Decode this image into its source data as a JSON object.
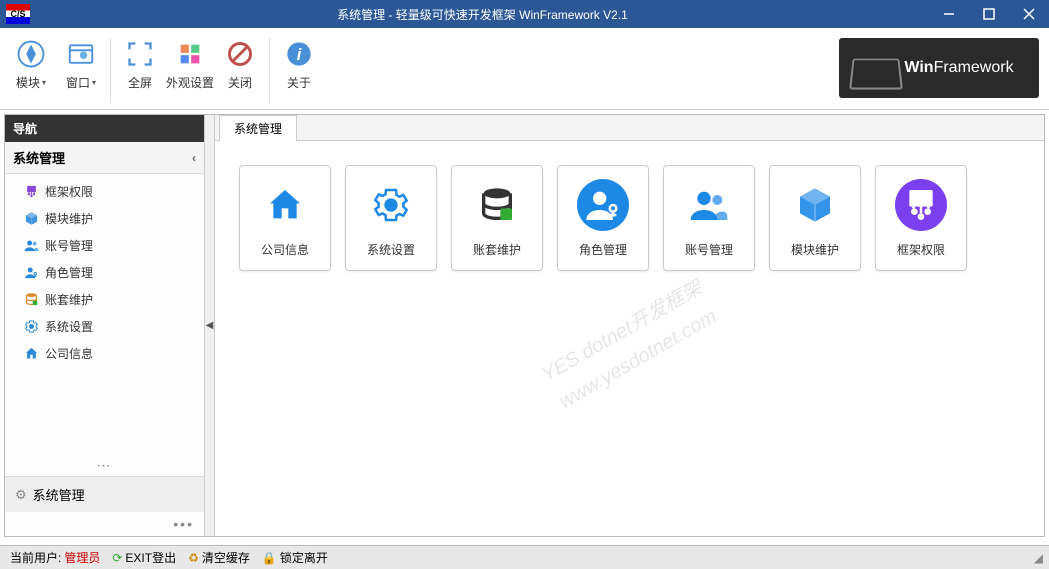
{
  "window": {
    "title": "系统管理 - 轻量级可快速开发框架 WinFramework V2.1"
  },
  "toolbar": {
    "module": "模块",
    "window": "窗口",
    "fullscreen": "全屏",
    "appearance": "外观设置",
    "close": "关闭",
    "about": "关于"
  },
  "brand": {
    "win": "Win",
    "framework": "Framework"
  },
  "sidebar": {
    "header": "导航",
    "section": "系统管理",
    "items": [
      {
        "label": "框架权限",
        "color": "#8a4ad9",
        "icon": "shield"
      },
      {
        "label": "模块维护",
        "color": "#2a8ad9",
        "icon": "cube"
      },
      {
        "label": "账号管理",
        "color": "#2a8ad9",
        "icon": "users"
      },
      {
        "label": "角色管理",
        "color": "#2a8ad9",
        "icon": "role"
      },
      {
        "label": "账套维护",
        "color": "#d98a2a",
        "icon": "db"
      },
      {
        "label": "系统设置",
        "color": "#2a8ad9",
        "icon": "gear"
      },
      {
        "label": "公司信息",
        "color": "#2a8ad9",
        "icon": "home"
      }
    ],
    "footer": "系统管理"
  },
  "tabs": [
    {
      "label": "系统管理"
    }
  ],
  "cards": [
    {
      "label": "公司信息",
      "bg": "#ffffff",
      "icon": "home",
      "iconColor": "#1e88e5"
    },
    {
      "label": "系统设置",
      "bg": "#ffffff",
      "icon": "gear",
      "iconColor": "#1e88e5"
    },
    {
      "label": "账套维护",
      "bg": "#ffffff",
      "icon": "db",
      "iconColor": "#333"
    },
    {
      "label": "角色管理",
      "bg": "#1e88e5",
      "icon": "role",
      "iconColor": "#fff",
      "round": true
    },
    {
      "label": "账号管理",
      "bg": "#ffffff",
      "icon": "users",
      "iconColor": "#1e88e5"
    },
    {
      "label": "模块维护",
      "bg": "#ffffff",
      "icon": "cube",
      "iconColor": "#1e88e5"
    },
    {
      "label": "框架权限",
      "bg": "#7b3ff0",
      "icon": "shield",
      "iconColor": "#fff",
      "round": true
    }
  ],
  "watermark": {
    "line1": "YES dotnet开发框架",
    "line2": "www.yesdotnet.com"
  },
  "statusbar": {
    "userLabel": "当前用户:",
    "userName": "管理员",
    "exit": "EXIT登出",
    "clearCache": "清空缓存",
    "lockLeave": "锁定离开"
  }
}
